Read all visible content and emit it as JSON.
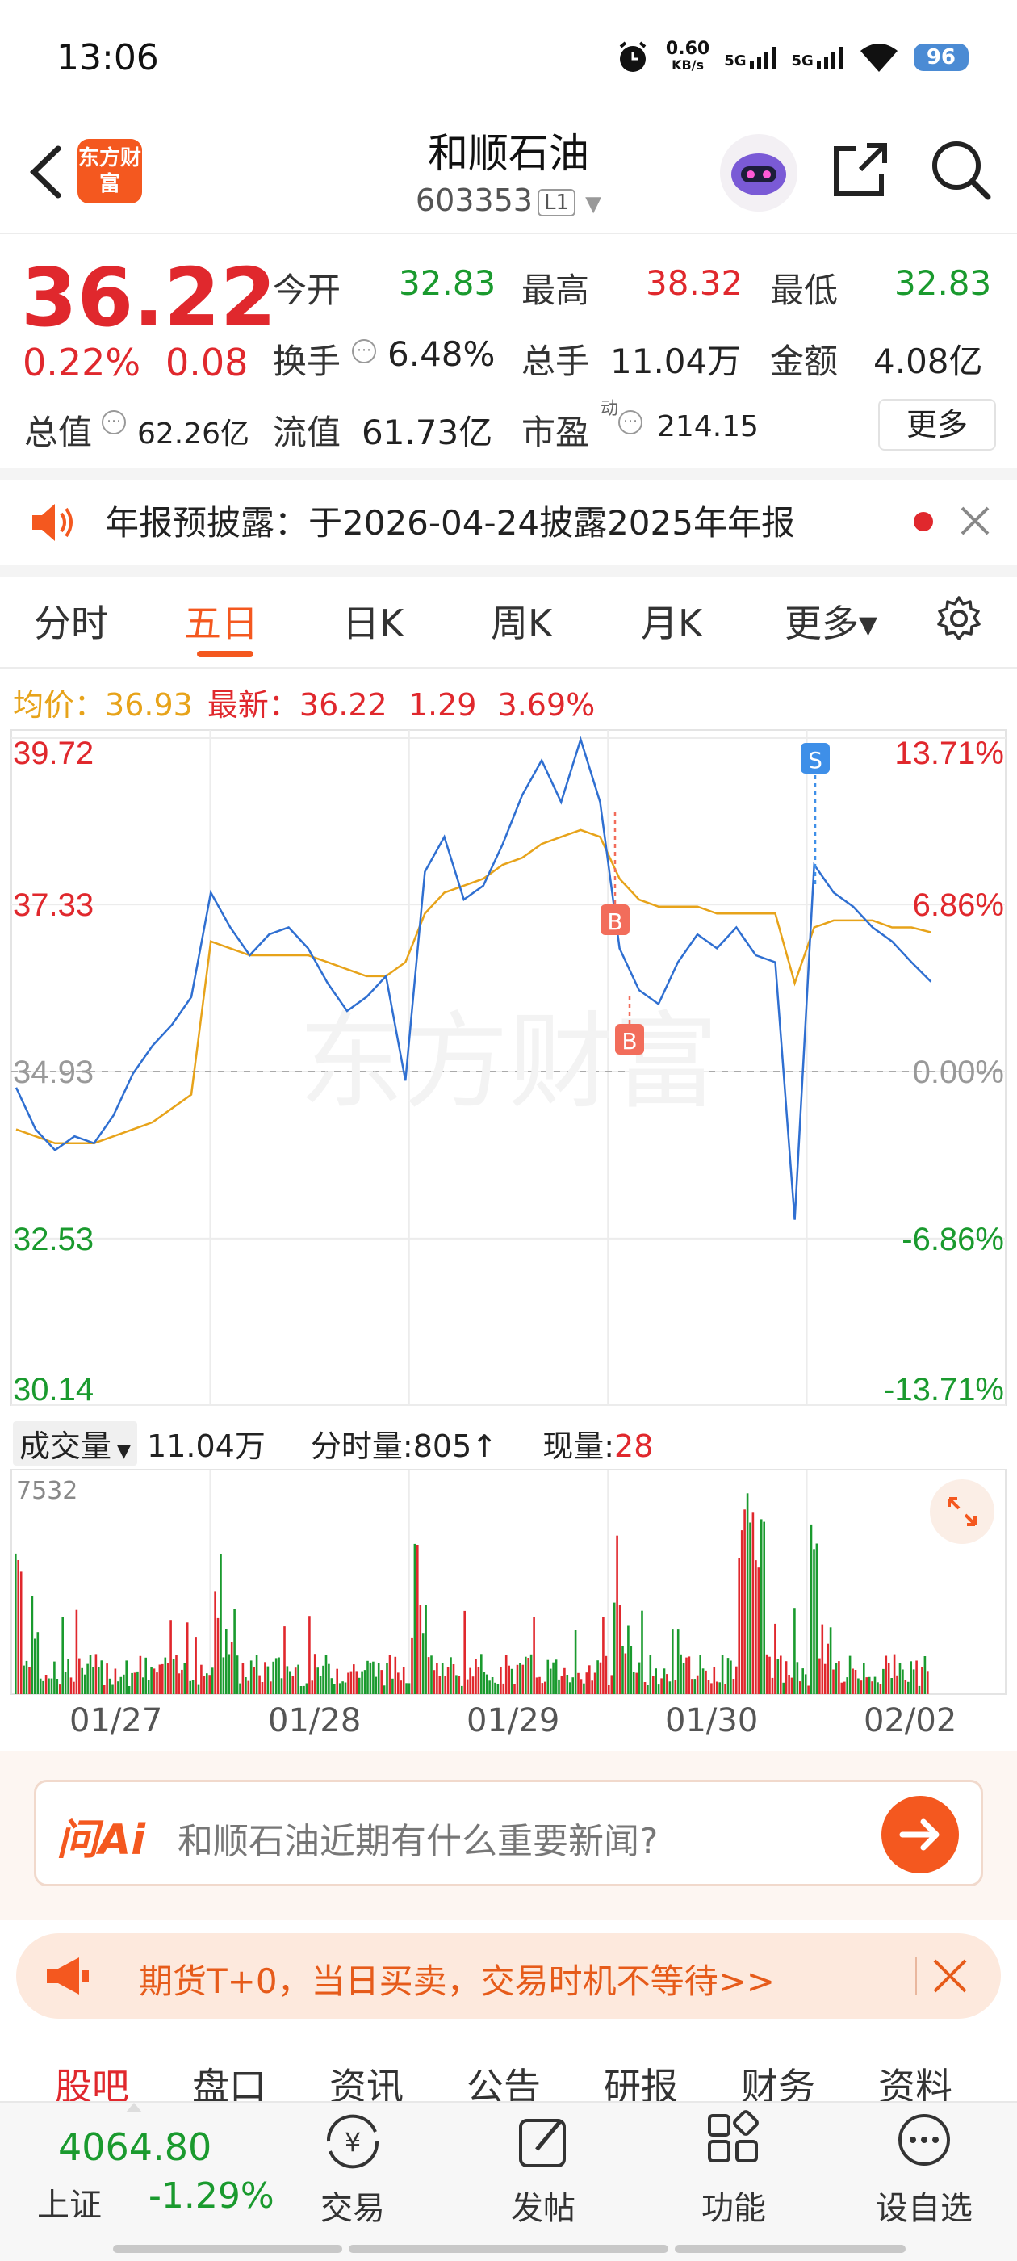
{
  "status_bar": {
    "time": "13:06",
    "net_speed": "0.60",
    "net_unit": "KB/s",
    "sig1": "5G",
    "sig2": "5G",
    "battery": "96"
  },
  "header": {
    "app_logo_text": "东方财富",
    "stock_name": "和顺石油",
    "stock_code": "603353",
    "level_badge": "L1"
  },
  "quote": {
    "price": "36.22",
    "change_pct": "0.22%",
    "change": "0.08",
    "open_label": "今开",
    "open": "32.83",
    "high_label": "最高",
    "high": "38.32",
    "low_label": "最低",
    "low": "32.83",
    "turnover_label": "换手",
    "turnover": "6.48%",
    "volume_label": "总手",
    "volume": "11.04万",
    "amount_label": "金额",
    "amount": "4.08亿",
    "mktcap_label": "总值",
    "mktcap": "62.26亿",
    "float_label": "流值",
    "float_cap": "61.73亿",
    "pe_label": "市盈",
    "pe_sup": "动",
    "pe": "214.15",
    "more_label": "更多"
  },
  "notice": {
    "text": "年报预披露：于2026-04-24披露2025年年报"
  },
  "tabs": [
    {
      "label": "分时"
    },
    {
      "label": "五日"
    },
    {
      "label": "日K"
    },
    {
      "label": "周K"
    },
    {
      "label": "月K"
    },
    {
      "label": "更多▾"
    }
  ],
  "chart_header": {
    "avg_label": "均价：",
    "avg": "36.93",
    "latest_label": "最新：",
    "latest": "36.22",
    "chg": "1.29",
    "chg_pct": "3.69%"
  },
  "chart_data": {
    "type": "line",
    "title": "",
    "x_labels": [
      "01/27",
      "01/28",
      "01/29",
      "01/30",
      "02/02"
    ],
    "y_ticks_left": [
      "39.72",
      "37.33",
      "34.93",
      "32.53",
      "30.14"
    ],
    "y_ticks_right": [
      "13.71%",
      "6.86%",
      "0.00%",
      "-6.86%",
      "-13.71%"
    ],
    "ylim": [
      30.14,
      39.72
    ],
    "prev_close": 34.93,
    "series": [
      {
        "name": "最新",
        "color": "#2f6fd1",
        "values": [
          34.7,
          34.1,
          33.8,
          34.0,
          33.9,
          34.3,
          34.9,
          35.3,
          35.6,
          36.0,
          37.5,
          37.0,
          36.6,
          36.9,
          37.0,
          36.7,
          36.2,
          35.8,
          36.0,
          36.3,
          34.8,
          37.8,
          38.3,
          37.4,
          37.6,
          38.2,
          38.9,
          39.4,
          38.8,
          39.7,
          38.8,
          36.7,
          36.1,
          35.9,
          36.5,
          36.9,
          36.7,
          37.0,
          36.6,
          36.5,
          32.8,
          37.9,
          37.5,
          37.3,
          37.0,
          36.8,
          36.5,
          36.22
        ]
      },
      {
        "name": "均价",
        "color": "#e7a31a",
        "values": [
          34.1,
          34.0,
          33.9,
          33.9,
          33.9,
          34.0,
          34.1,
          34.2,
          34.4,
          34.6,
          36.8,
          36.7,
          36.6,
          36.6,
          36.6,
          36.6,
          36.5,
          36.4,
          36.3,
          36.3,
          36.5,
          37.2,
          37.5,
          37.6,
          37.7,
          37.9,
          38.0,
          38.2,
          38.3,
          38.4,
          38.3,
          37.7,
          37.4,
          37.3,
          37.3,
          37.3,
          37.2,
          37.2,
          37.2,
          37.2,
          36.2,
          37.0,
          37.1,
          37.1,
          37.1,
          37.0,
          37.0,
          36.93
        ]
      }
    ],
    "markers": [
      {
        "label": "S",
        "color": "#3e8fe8"
      },
      {
        "label": "B",
        "color": "#f26d5b"
      },
      {
        "label": "B",
        "color": "#f26d5b"
      }
    ],
    "watermark": "东方财富"
  },
  "volume": {
    "dropdown_label": "成交量",
    "total": "11.04万",
    "tick_label": "分时量:",
    "tick_value": "805",
    "tick_arrow": "↑",
    "now_label": "现量:",
    "now_value": "28",
    "max_label": "7532"
  },
  "ask_ai": {
    "logo": "问Ai",
    "placeholder": "和顺石油近期有什么重要新闻?"
  },
  "promo": {
    "text": "期货T+0，当日买卖，交易时机不等待>>"
  },
  "bottom_tabs": [
    "股吧",
    "盘口",
    "资讯",
    "公告",
    "研报",
    "财务",
    "资料"
  ],
  "index": {
    "value": "4064.80",
    "name": "上证",
    "pct": "-1.29%"
  },
  "nav": [
    {
      "label": "交易"
    },
    {
      "label": "发帖"
    },
    {
      "label": "功能"
    },
    {
      "label": "设自选"
    }
  ],
  "colors": {
    "up": "#e0282d",
    "down": "#1a9a2e",
    "accent": "#f4581f",
    "price_line": "#2f6fd1",
    "avg_line": "#e7a31a"
  }
}
